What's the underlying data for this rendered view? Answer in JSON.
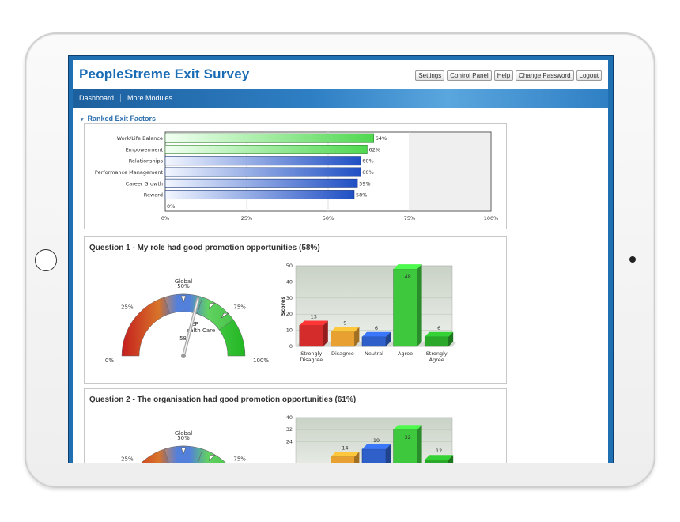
{
  "app": {
    "title": "PeopleStreme Exit Survey",
    "top_links": [
      "Settings",
      "Control Panel",
      "Help",
      "Change Password",
      "Logout"
    ],
    "nav": [
      "Dashboard",
      "More Modules"
    ]
  },
  "ranked": {
    "heading": "Ranked Exit Factors",
    "chart_data": {
      "type": "bar",
      "orientation": "horizontal",
      "categories": [
        "Work/Life Balance",
        "Empowerment",
        "Relationships",
        "Performance Management",
        "Career Growth",
        "Reward",
        ""
      ],
      "values": [
        64,
        62,
        60,
        60,
        59,
        58,
        0
      ],
      "value_labels": [
        "64%",
        "62%",
        "60%",
        "60%",
        "59%",
        "58%",
        "0%"
      ],
      "xlim": [
        0,
        100
      ],
      "x_ticks": [
        "0%",
        "25%",
        "50%",
        "75%",
        "100%"
      ],
      "colors": [
        "#4fd84f",
        "#4fd84f",
        "#2357c8",
        "#2357c8",
        "#2357c8",
        "#2357c8",
        "#2357c8"
      ]
    }
  },
  "q1": {
    "title": "Question 1 - My role had good promotion opportunities (58%)",
    "gauge": {
      "value": 58,
      "labels": {
        "global": "Global",
        "p0": "0%",
        "p25": "25%",
        "p50": "50%",
        "p75": "75%",
        "p100": "100%",
        "value_text": "58",
        "company_line1": "EP",
        "company_line2": "ealth Care"
      }
    },
    "chart_data": {
      "type": "bar",
      "categories": [
        "Strongly Disagree",
        "Disagree",
        "Neutral",
        "Agree",
        "Strongly Agree"
      ],
      "category_lines": [
        [
          "Strongly",
          "Disagree"
        ],
        [
          "Disagree"
        ],
        [
          "Neutral"
        ],
        [
          "Agree"
        ],
        [
          "Strongly",
          "Agree"
        ]
      ],
      "values": [
        13,
        9,
        6,
        48,
        6
      ],
      "ylabel": "Scores",
      "ylim": [
        0,
        50
      ],
      "y_ticks": [
        0,
        10,
        20,
        30,
        40,
        50
      ],
      "colors": [
        "#d42b2b",
        "#e8a030",
        "#2f5fc8",
        "#3ec83e",
        "#2aa82a"
      ]
    }
  },
  "q2": {
    "title": "Question 2 - The organisation had good promotion opportunities (61%)",
    "gauge": {
      "value": 61,
      "labels": {
        "global": "Global",
        "p25": "25%",
        "p50": "50%",
        "p75": "75%"
      }
    },
    "chart_data": {
      "type": "bar",
      "categories": [
        "",
        "",
        "",
        "",
        ""
      ],
      "values": [
        null,
        14,
        19,
        32,
        12
      ],
      "value_labels": [
        "",
        "14",
        "19",
        "32",
        "12"
      ],
      "ylim": [
        0,
        40
      ],
      "y_ticks": [
        24,
        32,
        40
      ],
      "colors": [
        "#d42b2b",
        "#e8a030",
        "#2f5fc8",
        "#3ec83e",
        "#2aa82a"
      ]
    }
  }
}
